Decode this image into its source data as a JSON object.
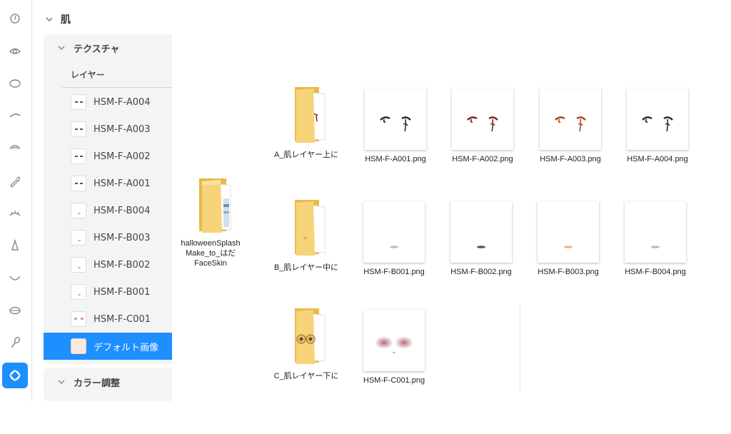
{
  "sidebar": {
    "icons": [
      {
        "name": "face-icon",
        "active": false
      },
      {
        "name": "eye-icon",
        "active": false
      },
      {
        "name": "iris-icon",
        "active": false
      },
      {
        "name": "eyebrow-icon",
        "active": false
      },
      {
        "name": "eyelash-icon",
        "active": false
      },
      {
        "name": "eyedropper-icon",
        "active": false
      },
      {
        "name": "lower-lash-icon",
        "active": false
      },
      {
        "name": "nose-icon",
        "active": false
      },
      {
        "name": "mouth-icon",
        "active": false
      },
      {
        "name": "lips-icon",
        "active": false
      },
      {
        "name": "brush-icon",
        "active": false
      },
      {
        "name": "skin-icon",
        "active": true
      }
    ]
  },
  "panel": {
    "section_title": "肌",
    "texture_title": "テクスチャ",
    "layer_label": "レイヤー",
    "layers": [
      {
        "label": "HSM-F-A004",
        "thumb": "eyes"
      },
      {
        "label": "HSM-F-A003",
        "thumb": "eyes"
      },
      {
        "label": "HSM-F-A002",
        "thumb": "eyes"
      },
      {
        "label": "HSM-F-A001",
        "thumb": "eyes"
      },
      {
        "label": "HSM-F-B004",
        "thumb": "dot"
      },
      {
        "label": "HSM-F-B003",
        "thumb": "dot"
      },
      {
        "label": "HSM-F-B002",
        "thumb": "dot"
      },
      {
        "label": "HSM-F-B001",
        "thumb": "dot"
      },
      {
        "label": "HSM-F-C001",
        "thumb": "blush"
      },
      {
        "label": "デフォルト画像",
        "thumb": "default",
        "selected": true
      }
    ],
    "color_title": "カラー調整"
  },
  "files": {
    "root_folder": {
      "line1": "halloweenSplash",
      "line2": "Make_to_はだ",
      "line3": "FaceSkin"
    },
    "folders": [
      {
        "label": "A_肌レイヤー上に",
        "content": "eyes"
      },
      {
        "label": "B_肌レイヤー中に",
        "content": "dot"
      },
      {
        "label": "C_肌レイヤー下に",
        "content": "glasses"
      }
    ],
    "row_a": [
      {
        "label": "HSM-F-A001.png",
        "tint": "#2b2b2b"
      },
      {
        "label": "HSM-F-A002.png",
        "tint": "#8a2020"
      },
      {
        "label": "HSM-F-A003.png",
        "tint": "#b0461d"
      },
      {
        "label": "HSM-F-A004.png",
        "tint": "#2b2b2b"
      }
    ],
    "row_b": [
      {
        "label": "HSM-F-B001.png",
        "tint": "#a9c9c0"
      },
      {
        "label": "HSM-F-B002.png",
        "tint": "#555555"
      },
      {
        "label": "HSM-F-B003.png",
        "tint": "#f0b48a"
      },
      {
        "label": "HSM-F-B004.png",
        "tint": "#b8b4dc"
      }
    ],
    "row_c": [
      {
        "label": "HSM-F-C001.png",
        "tint": "#b26470"
      }
    ]
  },
  "colors": {
    "accent": "#1e8fff",
    "folder_body": "#f7d37a",
    "folder_back": "#e9b94a"
  }
}
